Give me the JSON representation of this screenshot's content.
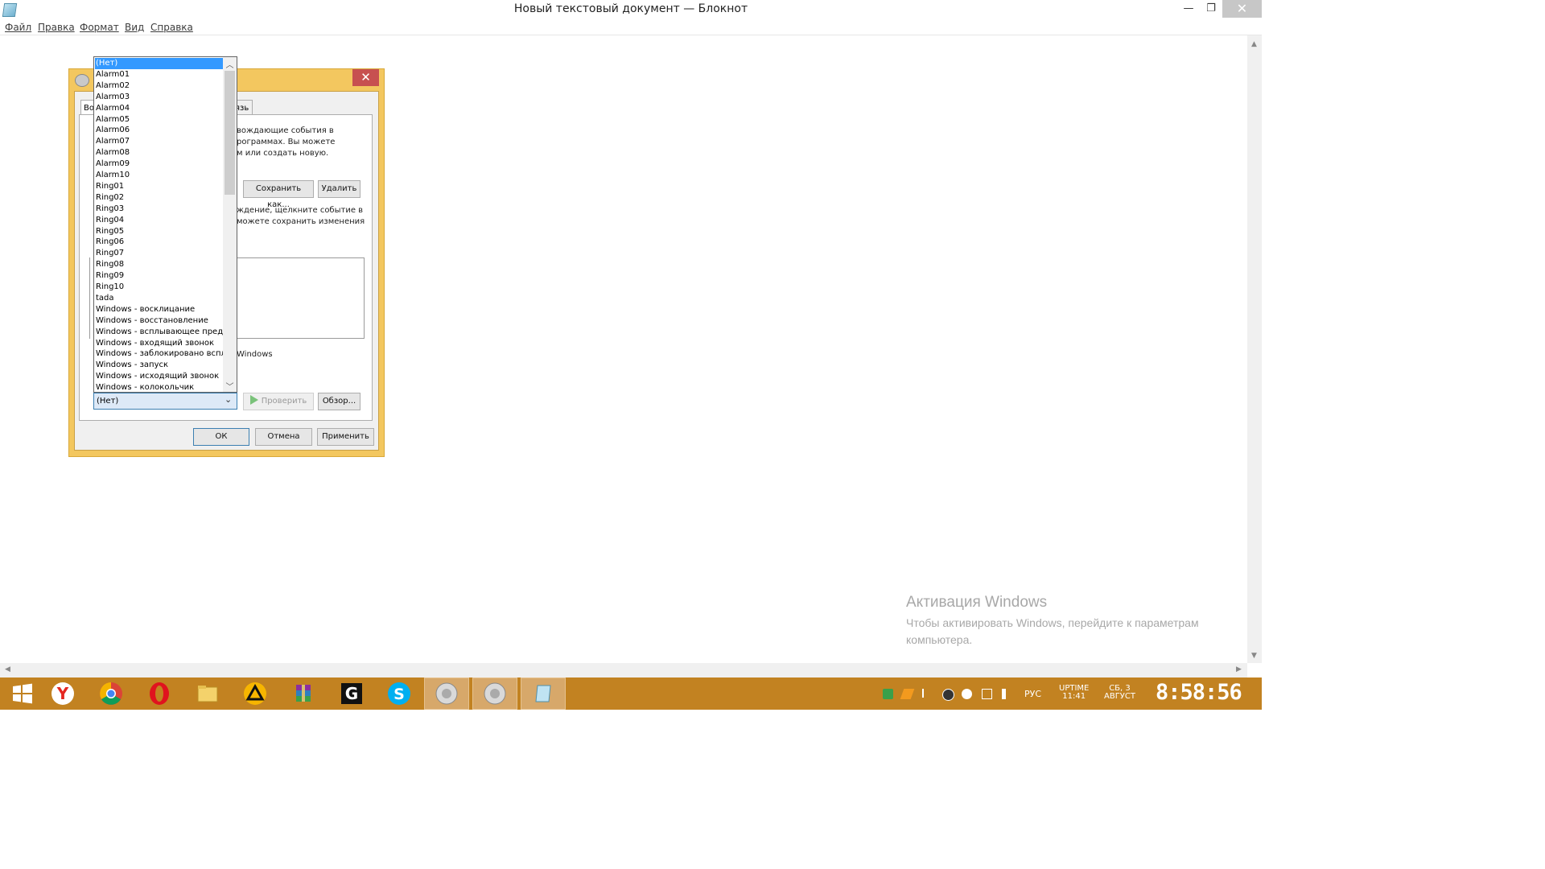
{
  "window": {
    "title": "Новый текстовый документ — Блокнот",
    "min_glyph": "—",
    "max_glyph": "❐",
    "close_glyph": "✕"
  },
  "menu": [
    "Файл",
    "Правка",
    "Формат",
    "Вид",
    "Справка"
  ],
  "activation": {
    "title": "Активация Windows",
    "line1": "Чтобы активировать Windows, перейдите к параметрам",
    "line2": "компьютера."
  },
  "dialog": {
    "close_glyph": "✕",
    "tab_left": "Во",
    "tab_right": "язь",
    "desc_lines": [
      "вождающие события в",
      "рограммах. Вы можете",
      "м или создать новую."
    ],
    "save_as": "Сохранить как...",
    "delete": "Удалить",
    "hint_lines": [
      "ждение, щелкните событие в",
      "можете сохранить изменения"
    ],
    "windows_fragment": "Windows",
    "test": "Проверить",
    "browse": "Обзор...",
    "ok": "ОК",
    "cancel": "Отмена",
    "apply": "Применить"
  },
  "sound_combo": {
    "value": "(Нет)",
    "options": [
      "(Нет)",
      "Alarm01",
      "Alarm02",
      "Alarm03",
      "Alarm04",
      "Alarm05",
      "Alarm06",
      "Alarm07",
      "Alarm08",
      "Alarm09",
      "Alarm10",
      "Ring01",
      "Ring02",
      "Ring03",
      "Ring04",
      "Ring05",
      "Ring06",
      "Ring07",
      "Ring08",
      "Ring09",
      "Ring10",
      "tada",
      "Windows - восклицание",
      "Windows - восстановление",
      "Windows - всплывающее преду",
      "Windows - входящий звонок",
      "Windows - заблокировано всплы",
      "Windows - запуск",
      "Windows - исходящий звонок",
      "Windows - колокольчик"
    ],
    "selected_index": 0,
    "selection_color": "#3399ff"
  },
  "taskbar": {
    "color": "#c28221",
    "apps": [
      {
        "name": "start-button",
        "icon": "windows-logo-icon"
      },
      {
        "name": "taskbar-yandex-browser",
        "icon": "yandex-icon"
      },
      {
        "name": "taskbar-chrome",
        "icon": "chrome-icon"
      },
      {
        "name": "taskbar-opera",
        "icon": "opera-icon"
      },
      {
        "name": "taskbar-file-explorer",
        "icon": "folder-icon"
      },
      {
        "name": "taskbar-aimp",
        "icon": "aimp-icon"
      },
      {
        "name": "taskbar-winrar",
        "icon": "winrar-icon"
      },
      {
        "name": "taskbar-gens",
        "icon": "gens-icon"
      },
      {
        "name": "taskbar-skype",
        "icon": "skype-icon"
      },
      {
        "name": "taskbar-sound",
        "icon": "speaker-icon"
      },
      {
        "name": "taskbar-sound-active",
        "icon": "speaker-icon"
      },
      {
        "name": "taskbar-notepad",
        "icon": "notepad-icon"
      }
    ],
    "lang": "РУС",
    "uptime_label": "UPTIME",
    "uptime_value": "11:41",
    "date_line1": "СБ, 3",
    "date_line2": "АВГУСТ",
    "clock": "8:58:56"
  }
}
